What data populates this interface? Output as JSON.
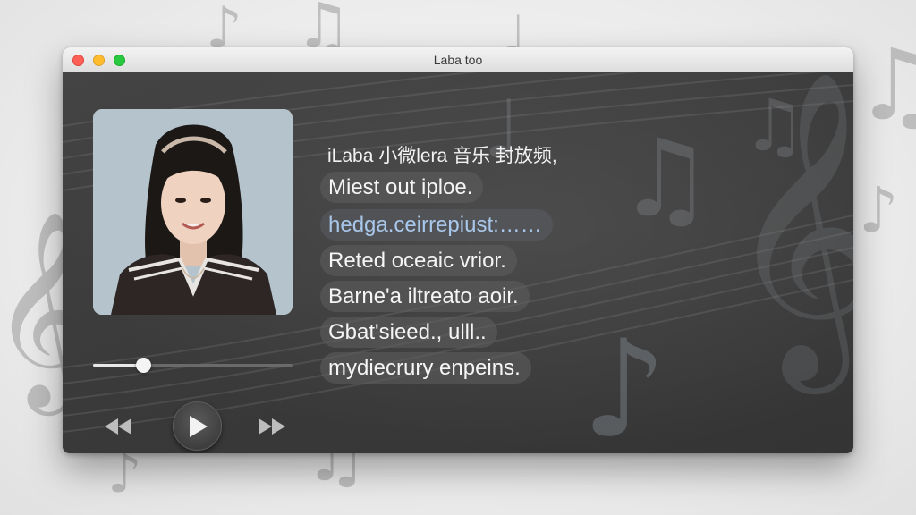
{
  "window": {
    "title": "Laba too"
  },
  "player": {
    "heading": "iLaba 小微lera 音乐 封放频,",
    "tracks": [
      {
        "label": "Miest out iploe.",
        "active": false
      },
      {
        "label": "hedga.ceirrepiust:……",
        "active": true
      },
      {
        "label": "Reted oceaic vrior.",
        "active": false
      },
      {
        "label": "Barne'a iltreato aoir.",
        "active": false
      },
      {
        "label": "Gbat'sieed., ulll..",
        "active": false
      },
      {
        "label": "mydiecrury enpeins.",
        "active": false
      }
    ],
    "progress_fraction": 0.25,
    "controls": {
      "prev_icon": "rewind-icon",
      "play_icon": "play-icon",
      "next_icon": "fast-forward-icon"
    }
  },
  "colors": {
    "accent_track_text": "#a9c7ea",
    "close": "#fe5f57",
    "minimize": "#febc2e",
    "maximize": "#28c840"
  }
}
